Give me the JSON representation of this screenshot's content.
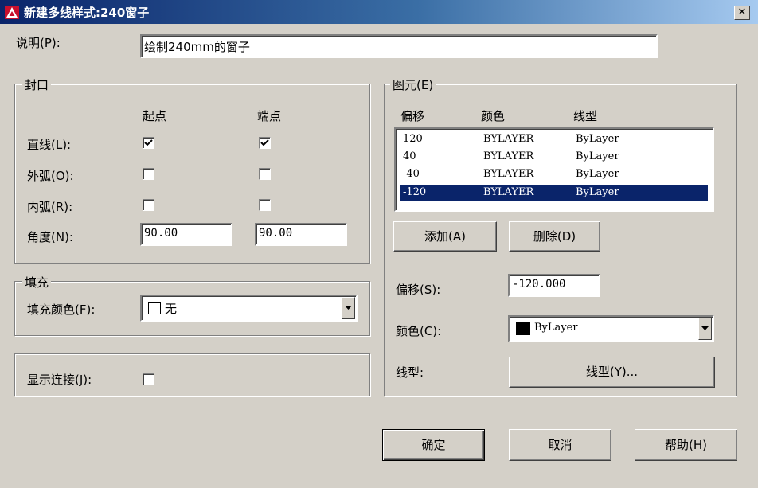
{
  "window": {
    "title": "新建多线样式:240窗子",
    "close": "✕"
  },
  "description": {
    "label": "说明(P):",
    "value": "绘制240mm的窗子"
  },
  "caps": {
    "legend": "封口",
    "col_start": "起点",
    "col_end": "端点",
    "line": {
      "label": "直线(L):",
      "start_checked": true,
      "end_checked": true
    },
    "outer_arc": {
      "label": "外弧(O):",
      "start_checked": false,
      "end_checked": false
    },
    "inner_arc": {
      "label": "内弧(R):",
      "start_checked": false,
      "end_checked": false
    },
    "angle": {
      "label": "角度(N):",
      "start": "90.00",
      "end": "90.00"
    }
  },
  "fill": {
    "legend": "填充",
    "color_label": "填充颜色(F):",
    "color_value": "无"
  },
  "show_joints": {
    "label": "显示连接(J):",
    "checked": false
  },
  "elements": {
    "legend": "图元(E)",
    "headers": {
      "offset": "偏移",
      "color": "颜色",
      "linetype": "线型"
    },
    "rows": [
      {
        "offset": "120",
        "color": "BYLAYER",
        "linetype": "ByLayer"
      },
      {
        "offset": "40",
        "color": "BYLAYER",
        "linetype": "ByLayer"
      },
      {
        "offset": "-40",
        "color": "BYLAYER",
        "linetype": "ByLayer"
      },
      {
        "offset": "-120",
        "color": "BYLAYER",
        "linetype": "ByLayer"
      }
    ],
    "selected_row": 3,
    "add_label": "添加(A)",
    "delete_label": "删除(D)",
    "offset_label": "偏移(S):",
    "offset_value": "-120.000",
    "color_label": "颜色(C):",
    "color_value": "ByLayer",
    "color_swatch": "#000000",
    "linetype_label": "线型:",
    "linetype_button": "线型(Y)..."
  },
  "buttons": {
    "ok": "确定",
    "cancel": "取消",
    "help": "帮助(H)"
  },
  "colors": {
    "titlebar_start": "#0a246a",
    "titlebar_end": "#a6caf0",
    "face": "#d4d0c8",
    "selection": "#0a246a",
    "app_icon": "#c8102e"
  }
}
